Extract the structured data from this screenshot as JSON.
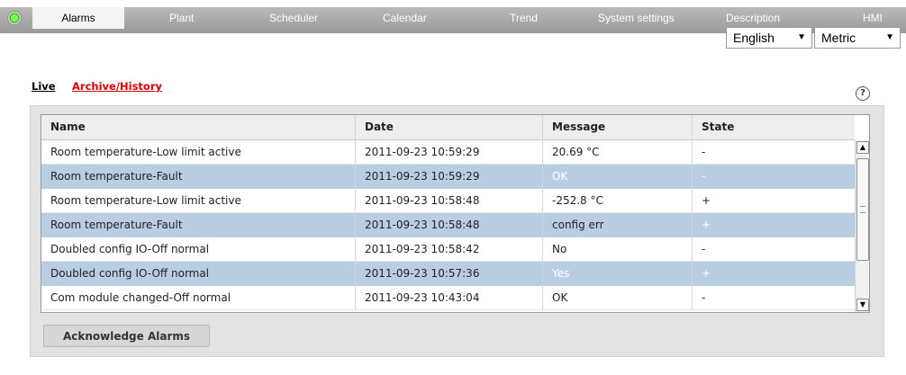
{
  "nav": {
    "tabs": [
      {
        "label": "Alarms",
        "active": true
      },
      {
        "label": "Plant"
      },
      {
        "label": "Scheduler"
      },
      {
        "label": "Calendar"
      },
      {
        "label": "Trend"
      },
      {
        "label": "System settings"
      },
      {
        "label": "Description"
      },
      {
        "label": "HMI"
      }
    ],
    "status_icon": "status-led-green",
    "language": "English",
    "units": "Metric"
  },
  "subtabs": {
    "live": "Live",
    "archive": "Archive/History",
    "help_icon": "?"
  },
  "colors": {
    "archive_link": "#e00000",
    "alt_row": "#b9cde3",
    "alt_state": "#ffffff"
  },
  "table": {
    "headers": [
      "Name",
      "Date",
      "Message",
      "State"
    ],
    "rows": [
      {
        "name": "Room temperature-Low limit active",
        "date": "2011-09-23 10:59:29",
        "message": "20.69  °C",
        "state": "-"
      },
      {
        "name": "Room temperature-Fault",
        "date": "2011-09-23 10:59:29",
        "message": "OK",
        "state": "-"
      },
      {
        "name": "Room temperature-Low limit active",
        "date": "2011-09-23 10:58:48",
        "message": "-252.8  °C",
        "state": "+"
      },
      {
        "name": "Room temperature-Fault",
        "date": "2011-09-23 10:58:48",
        "message": "config err",
        "state": "+"
      },
      {
        "name": "Doubled config IO-Off normal",
        "date": "2011-09-23 10:58:42",
        "message": "No",
        "state": "-"
      },
      {
        "name": "Doubled config IO-Off normal",
        "date": "2011-09-23 10:57:36",
        "message": "Yes",
        "state": "+"
      },
      {
        "name": "Com module changed-Off normal",
        "date": "2011-09-23 10:43:04",
        "message": "OK",
        "state": "-"
      }
    ]
  },
  "actions": {
    "acknowledge": "Acknowledge Alarms"
  }
}
